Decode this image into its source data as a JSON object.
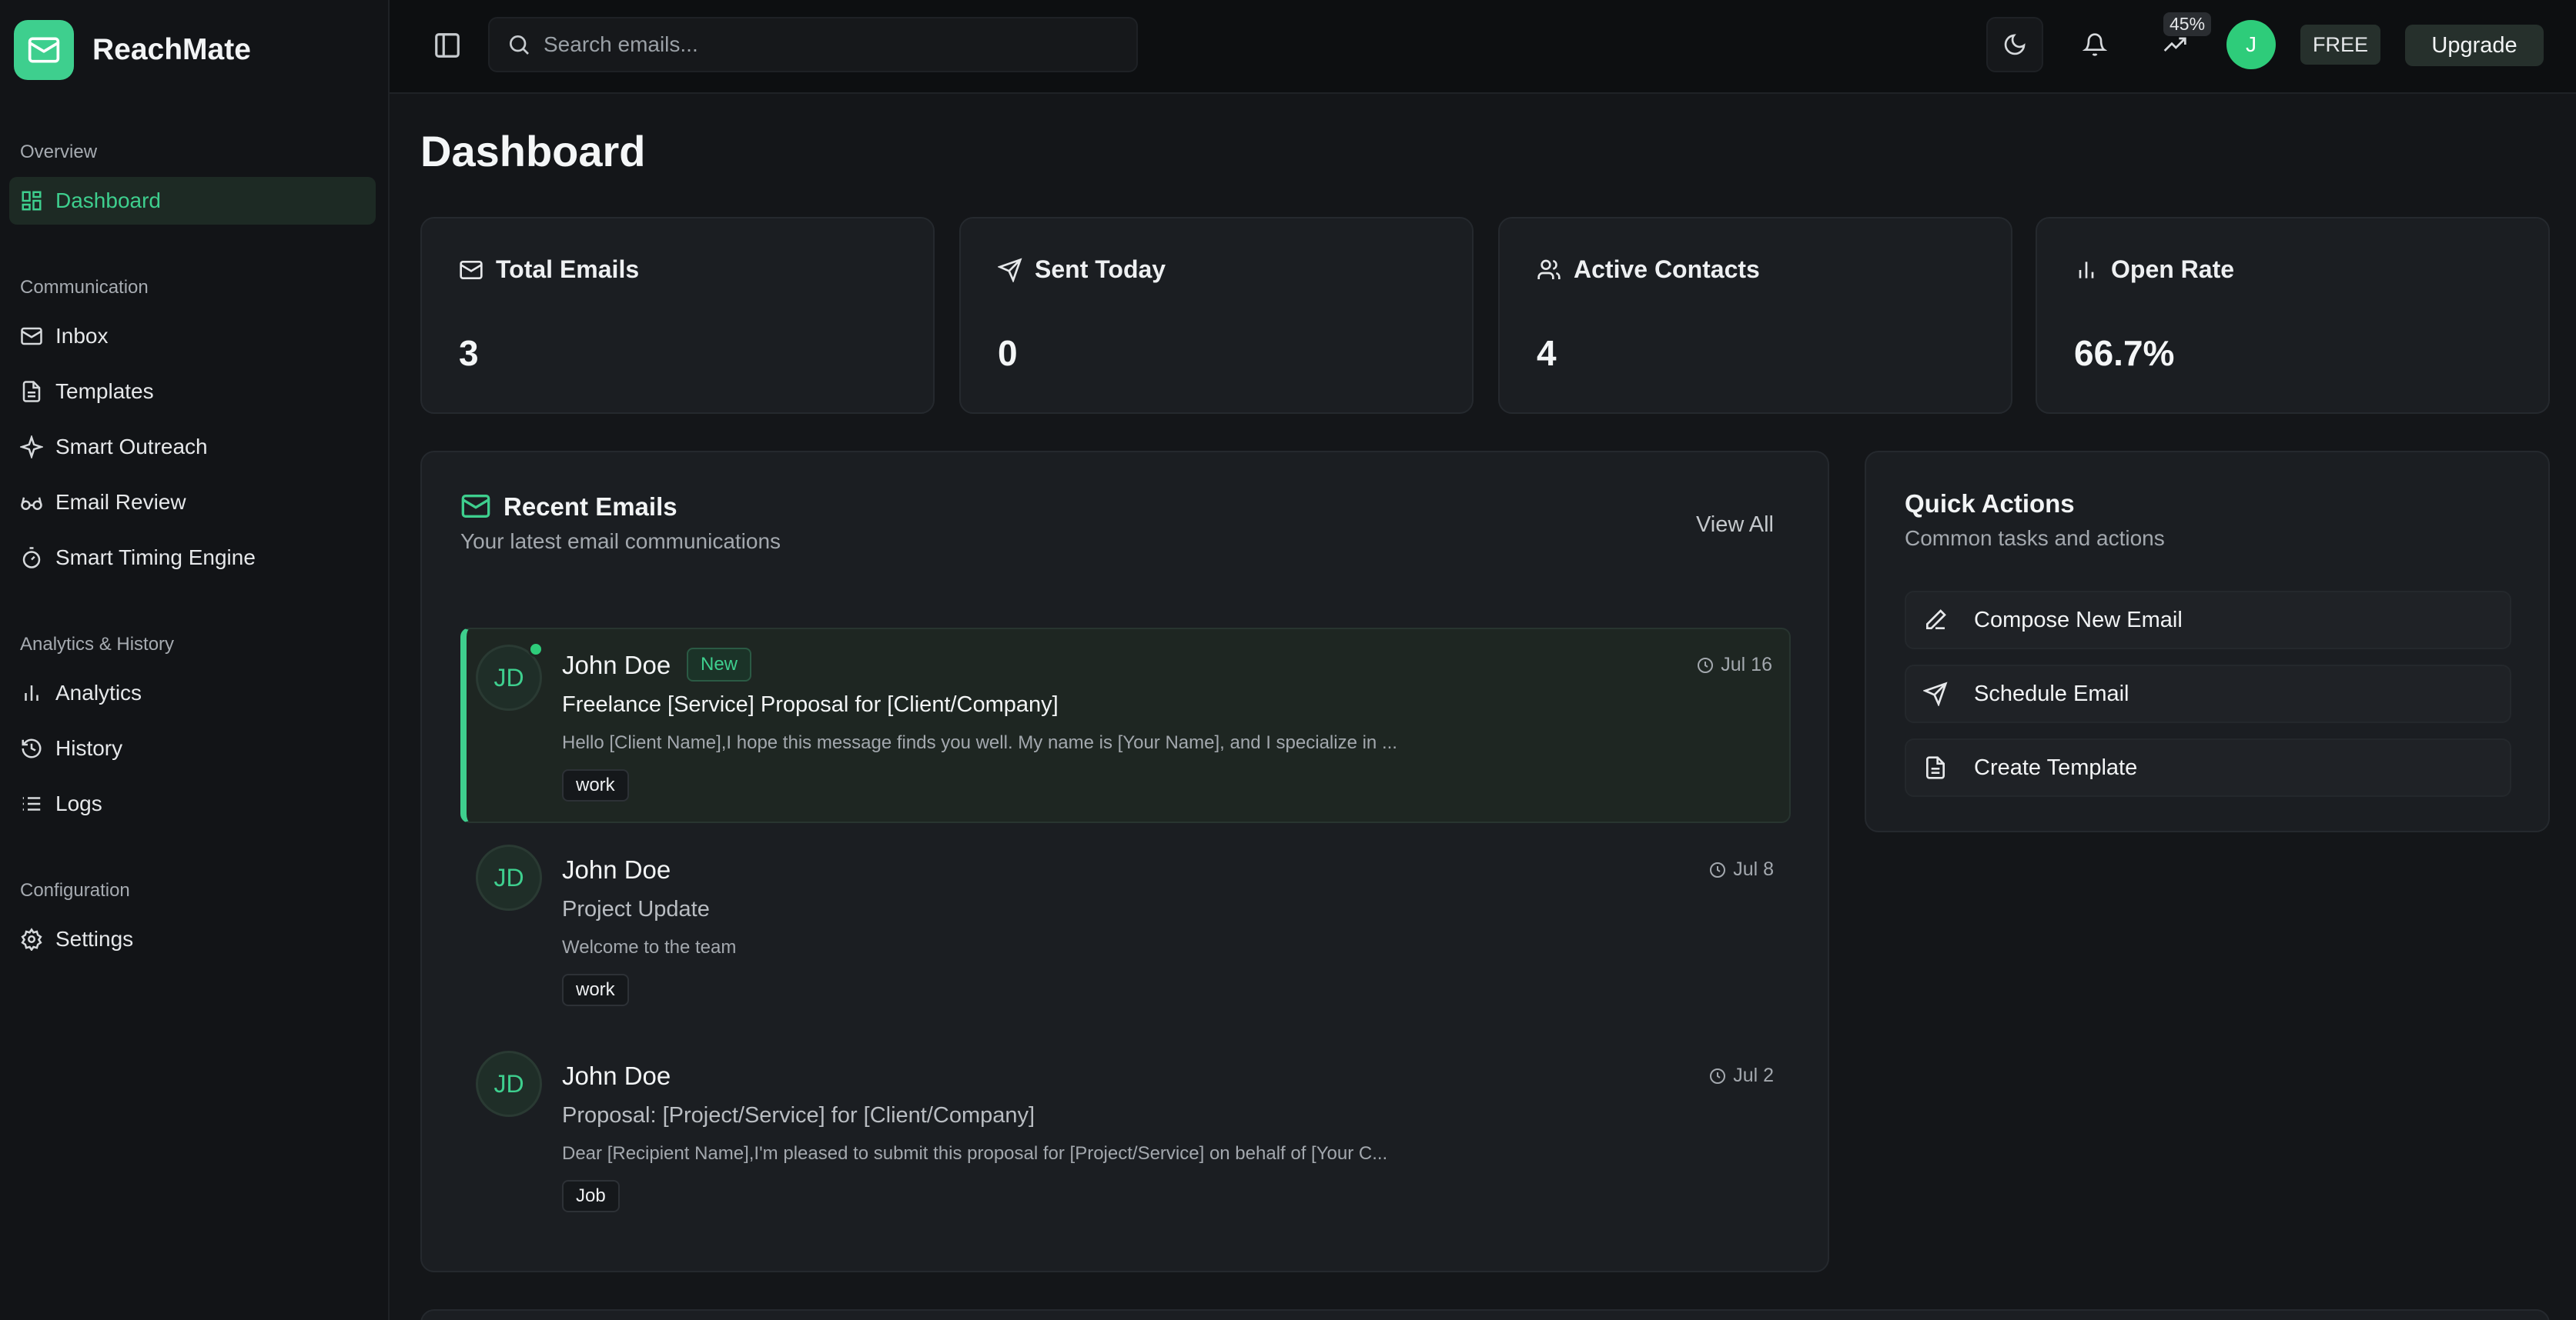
{
  "app": {
    "name": "ReachMate"
  },
  "sidebar": {
    "sections": [
      {
        "title": "Overview",
        "items": [
          {
            "label": "Dashboard",
            "icon": "layout-dashboard-icon",
            "active": true
          }
        ]
      },
      {
        "title": "Communication",
        "items": [
          {
            "label": "Inbox",
            "icon": "mail-icon"
          },
          {
            "label": "Templates",
            "icon": "file-text-icon"
          },
          {
            "label": "Smart Outreach",
            "icon": "sparkle-icon"
          },
          {
            "label": "Email Review",
            "icon": "glasses-icon"
          },
          {
            "label": "Smart Timing Engine",
            "icon": "timer-icon"
          }
        ]
      },
      {
        "title": "Analytics & History",
        "items": [
          {
            "label": "Analytics",
            "icon": "bar-chart-icon"
          },
          {
            "label": "History",
            "icon": "history-icon"
          },
          {
            "label": "Logs",
            "icon": "list-icon"
          }
        ]
      },
      {
        "title": "Configuration",
        "items": [
          {
            "label": "Settings",
            "icon": "gear-icon"
          }
        ]
      }
    ]
  },
  "topbar": {
    "search_placeholder": "Search emails...",
    "usage_percent": "45%",
    "avatar_initial": "J",
    "plan": "FREE",
    "upgrade_label": "Upgrade"
  },
  "page": {
    "title": "Dashboard"
  },
  "stats": [
    {
      "label": "Total Emails",
      "value": "3",
      "icon": "mail-icon"
    },
    {
      "label": "Sent Today",
      "value": "0",
      "icon": "send-icon"
    },
    {
      "label": "Active Contacts",
      "value": "4",
      "icon": "users-icon"
    },
    {
      "label": "Open Rate",
      "value": "66.7%",
      "icon": "bar-chart-icon"
    }
  ],
  "recent": {
    "title": "Recent Emails",
    "subtitle": "Your latest email communications",
    "view_all": "View All",
    "emails": [
      {
        "initials": "JD",
        "from": "John Doe",
        "badge": "New",
        "date": "Jul 16",
        "subject": "Freelance [Service] Proposal for [Client/Company]",
        "preview": "Hello [Client Name],I hope this message finds you well. My name is [Your Name], and I specialize in ...",
        "tag": "work",
        "unread": true
      },
      {
        "initials": "JD",
        "from": "John Doe",
        "date": "Jul 8",
        "subject": "Project Update",
        "preview": "Welcome to the team",
        "tag": "work",
        "unread": false
      },
      {
        "initials": "JD",
        "from": "John Doe",
        "date": "Jul 2",
        "subject": "Proposal: [Project/Service] for [Client/Company]",
        "preview": "Dear [Recipient Name],I'm pleased to submit this proposal for [Project/Service] on behalf of [Your C...",
        "tag": "Job",
        "unread": false
      }
    ]
  },
  "quick_actions": {
    "title": "Quick Actions",
    "subtitle": "Common tasks and actions",
    "items": [
      {
        "label": "Compose New Email",
        "icon": "pencil-icon"
      },
      {
        "label": "Schedule Email",
        "icon": "send-icon"
      },
      {
        "label": "Create Template",
        "icon": "file-text-icon"
      }
    ]
  },
  "colors": {
    "accent": "#3ecf8e",
    "background": "#141619",
    "card": "#1b1e22"
  }
}
